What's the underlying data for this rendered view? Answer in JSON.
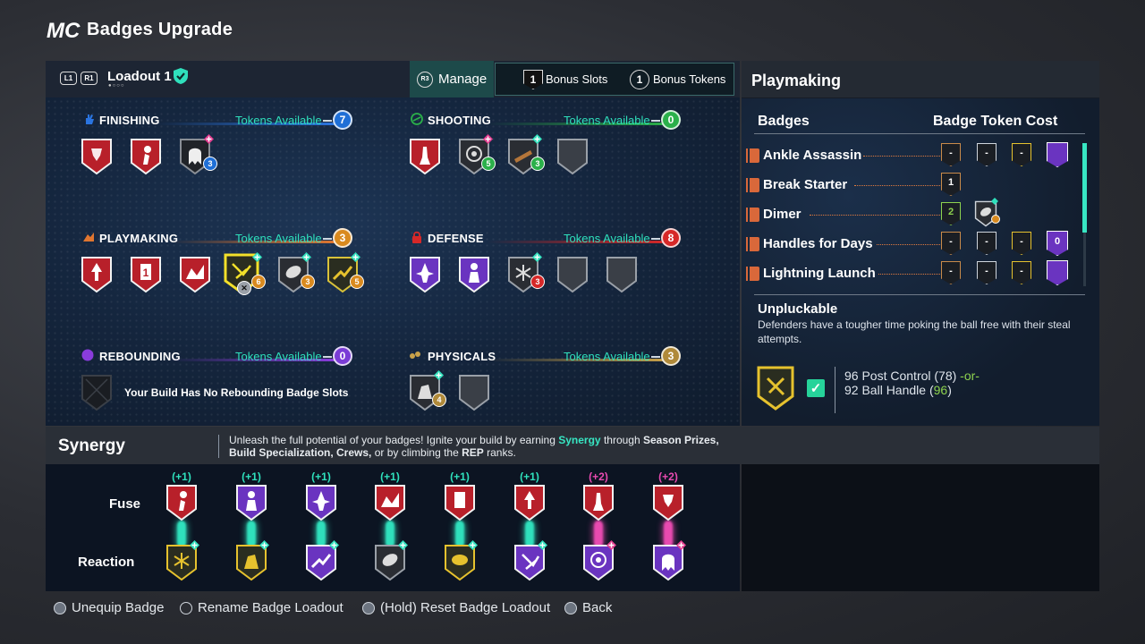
{
  "header": {
    "logo_text": "MC",
    "title": "Badges Upgrade"
  },
  "loadout": {
    "l1": "L1",
    "r1": "R1",
    "name": "Loadout 1",
    "dots": "●○○○",
    "manage_key": "R3",
    "manage_label": "Manage",
    "bonus_slots": "1",
    "bonus_slots_label": "Bonus Slots",
    "bonus_tokens": "1",
    "bonus_tokens_label": "Bonus Tokens"
  },
  "categories": [
    {
      "name": "FINISHING",
      "tokens_label": "Tokens Available",
      "tokens": "7",
      "token_color": "#1f6fd6",
      "line": "#2a74e0",
      "icon": "hand-icon"
    },
    {
      "name": "SHOOTING",
      "tokens_label": "Tokens Available",
      "tokens": "0",
      "token_color": "#2bb04a",
      "line": "#2bb04a",
      "icon": "shooting-icon"
    },
    {
      "name": "PLAYMAKING",
      "tokens_label": "Tokens Available",
      "tokens": "3",
      "token_color": "#d98a1f",
      "line": "#e07630",
      "icon": "playmaking-icon"
    },
    {
      "name": "DEFENSE",
      "tokens_label": "Tokens Available",
      "tokens": "8",
      "token_color": "#d62828",
      "line": "#d62828",
      "icon": "lock-icon"
    },
    {
      "name": "REBOUNDING",
      "tokens_label": "Tokens Available",
      "tokens": "0",
      "token_color": "#7a3cd6",
      "line": "#8a3cdd",
      "icon": "rebounding-icon"
    },
    {
      "name": "PHYSICALS",
      "tokens_label": "Tokens Available",
      "tokens": "3",
      "token_color": "#b08a3a",
      "line": "#c9a24a",
      "icon": "physicals-icon"
    }
  ],
  "badge_levels": {
    "finishing_3": "3",
    "shooting_2": "5",
    "shooting_3": "3",
    "playmaking_4": "6",
    "playmaking_5": "3",
    "playmaking_6": "5",
    "defense_3": "3",
    "physicals_1": "4"
  },
  "playmaking_1_tier": "1",
  "rebounding_empty": "Your Build Has No Rebounding Badge Slots",
  "right_panel": {
    "title": "Playmaking",
    "col_badges": "Badges",
    "col_cost": "Badge Token Cost",
    "rows": [
      {
        "name": "Ankle Assassin",
        "costs": [
          "-",
          "-",
          "-",
          ""
        ]
      },
      {
        "name": "Break Starter",
        "costs": [
          "1"
        ]
      },
      {
        "name": "Dimer",
        "costs": [
          "2"
        ]
      },
      {
        "name": "Handles for Days",
        "costs": [
          "-",
          "-",
          "-",
          "0"
        ]
      },
      {
        "name": "Lightning Launch",
        "costs": [
          "-",
          "-",
          "-",
          ""
        ]
      }
    ],
    "desc_title": "Unpluckable",
    "desc_text": "Defenders have a tougher time poking the ball free with their steal attempts.",
    "req_line1_a": "96 Post Control (78)",
    "req_line1_b": " -or-",
    "req_line2_a": "92 Ball Handle (",
    "req_line2_b": "96",
    "req_line2_c": ")"
  },
  "synergy": {
    "title": "Synergy",
    "desc_1": "Unleash the full potential of your badges! Ignite your build by earning ",
    "desc_synergy": "Synergy",
    "desc_2": " through ",
    "desc_season": "Season Prizes, Build Specialization, Crews,",
    "desc_3": " or by climbing the ",
    "desc_rep": "REP",
    "desc_4": " ranks.",
    "fuse_label": "Fuse",
    "reaction_label": "Reaction",
    "bonuses": [
      "(+1)",
      "(+1)",
      "(+1)",
      "(+1)",
      "(+1)",
      "(+1)",
      "(+2)",
      "(+2)"
    ]
  },
  "footer": {
    "unequip": "Unequip Badge",
    "rename": "Rename Badge Loadout",
    "reset": "(Hold) Reset Badge Loadout",
    "back": "Back"
  },
  "colors": {
    "accent_teal": "#37e6c3",
    "tier_red": "#c9232d",
    "tier_purple": "#7d3fd6",
    "tier_gold": "#e6c22e",
    "tier_bronze": "#b5763a",
    "tier_empty": "#3a3f47"
  }
}
